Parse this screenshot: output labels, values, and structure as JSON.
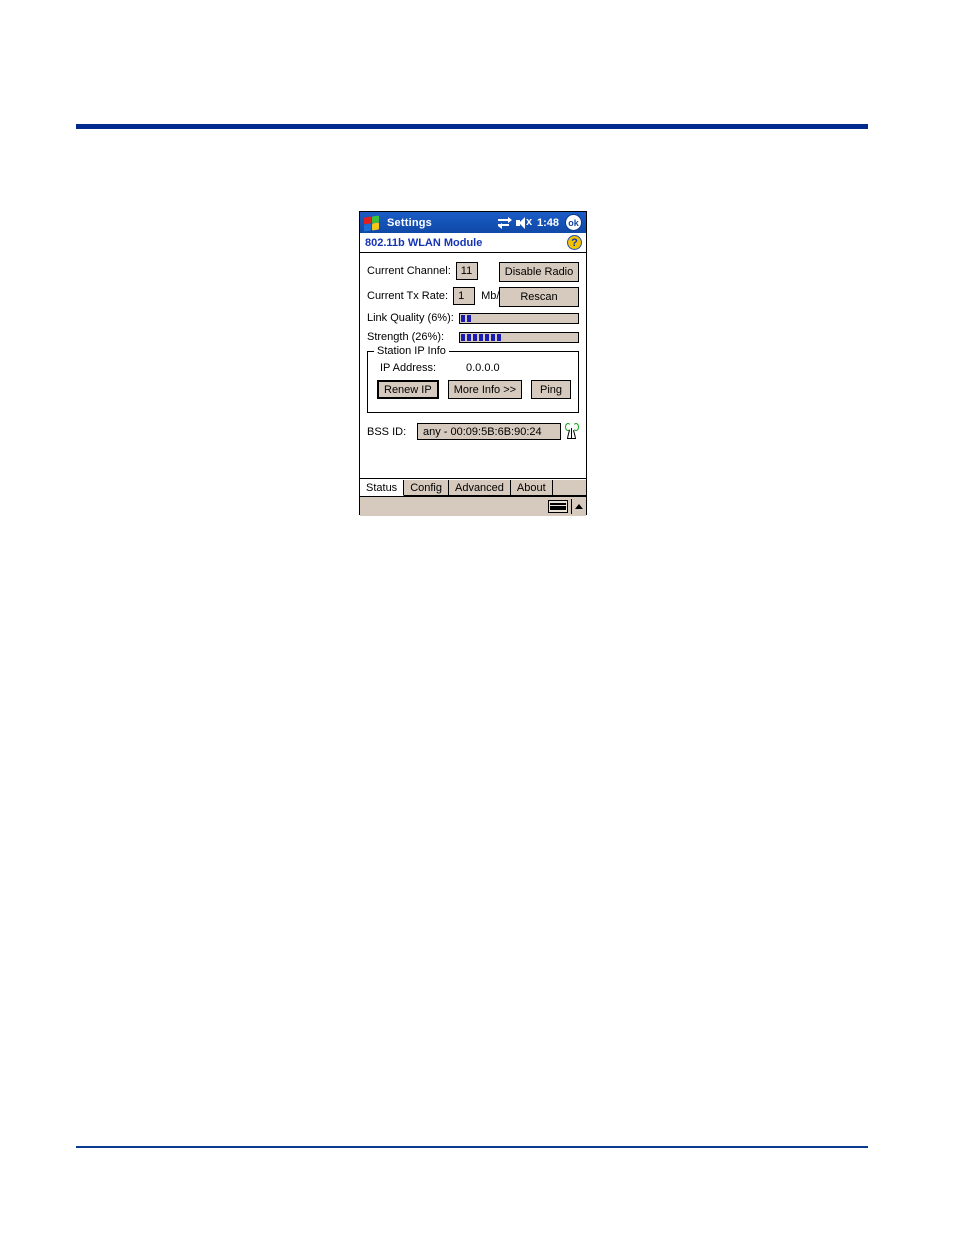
{
  "device": {
    "titlebar": {
      "app_title": "Settings",
      "time": "1:48",
      "ok_label": "ok",
      "connectivity_icon": "connectivity-icon",
      "volume_icon": "speaker-mute-icon",
      "windows_logo": "windows-logo-icon"
    },
    "subheader": {
      "title": "802.11b WLAN Module",
      "help_icon": "help-icon"
    },
    "status_tab": {
      "current_channel_label": "Current Channel:",
      "current_channel_value": "11",
      "current_tx_rate_label": "Current Tx Rate:",
      "current_tx_rate_value": "1",
      "current_tx_rate_unit": "Mb/s",
      "disable_radio_label": "Disable Radio",
      "rescan_label": "Rescan",
      "link_quality_label": "Link Quality (6%):",
      "link_quality_percent": 6,
      "link_quality_segments": 2,
      "strength_label": "Strength (26%):",
      "strength_percent": 26,
      "strength_segments": 7,
      "meter_total_segments": 30,
      "station_ip_info": {
        "group_title": "Station IP Info",
        "ip_address_label": "IP Address:",
        "ip_address_value": "0.0.0.0",
        "renew_ip_label": "Renew IP",
        "more_info_label": "More Info >>",
        "ping_label": "Ping"
      },
      "bss_id_label": "BSS ID:",
      "bss_id_value": "any - 00:09:5B:6B:90:24",
      "antenna_icon": "antenna-signal-icon"
    },
    "tabs": [
      {
        "label": "Status",
        "active": true
      },
      {
        "label": "Config",
        "active": false
      },
      {
        "label": "Advanced",
        "active": false
      },
      {
        "label": "About",
        "active": false
      }
    ],
    "statusbar": {
      "sip_keyboard_icon": "keyboard-icon",
      "sip_arrow_icon": "chevron-up-icon"
    }
  },
  "colors": {
    "titlebar_blue": "#1550b4",
    "subheader_text_blue": "#1535b5",
    "control_face": "#d6c9bd",
    "meter_fill": "#1a1ab4",
    "rule_blue": "#012a8e",
    "antenna_green": "#17a117"
  }
}
